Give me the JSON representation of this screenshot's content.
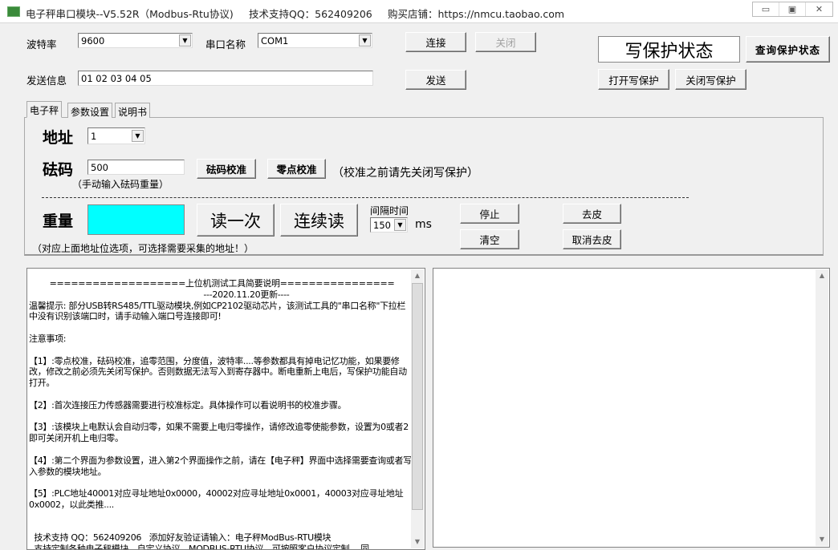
{
  "window": {
    "title": "电子秤串口模块--V5.52R（Modbus-Rtu协议)",
    "support": "技术支持QQ：562409206",
    "shop": "购买店铺：https://nmcu.taobao.com",
    "controls": {
      "minimize": "▭",
      "maximize": "▣",
      "close": "✕"
    }
  },
  "serial": {
    "baud_label": "波特率",
    "baud_value": "9600",
    "port_label": "串口名称",
    "port_value": "COM1",
    "connect": "连接",
    "close": "关闭",
    "send_label": "发送信息",
    "send_value": "01 02 03 04 05",
    "send": "发送"
  },
  "protect": {
    "status": "写保护状态",
    "query": "查询保护状态",
    "open": "打开写保护",
    "close": "关闭写保护"
  },
  "tabs": [
    {
      "label": "电子秤",
      "active": true
    },
    {
      "label": "参数设置"
    },
    {
      "label": "说明书"
    }
  ],
  "scale": {
    "addr_label": "地址",
    "addr_value": "1",
    "weight_label": "砝码",
    "weight_value": "500",
    "weight_hint": "（手动输入砝码重量）",
    "cal_weight": "砝码校准",
    "cal_zero": "零点校准",
    "cal_note": "（校准之前请先关闭写保护）",
    "reading_label": "重量",
    "reading_value": "",
    "reading_color": "#00ffff",
    "read_once": "读一次",
    "read_cont": "连续读",
    "interval_label": "间隔时间",
    "interval_value": "150",
    "interval_unit": "ms",
    "stop": "停止",
    "clear": "清空",
    "tare": "去皮",
    "cancel_tare": "取消去皮",
    "footnote": "（对应上面地址位选项，可选择需要采集的地址！）"
  },
  "instructions": "        ===================上位机测试工具简要说明================\n                                                                    ---2020.11.20更新----\n温馨提示: 部分USB转RS485/TTL驱动模块,例如CP2102驱动芯片，该测试工具的\"串口名称\"下拉栏中没有识别该端口时，请手动输入端口号连接即可!\n\n注意事项:\n\n【1】:零点校准，砝码校准，追零范围，分度值，波特率....等参数都具有掉电记忆功能，如果要修改，修改之前必须先关闭写保护。否则数据无法写入到寄存器中。断电重新上电后，写保护功能自动打开。\n\n【2】:首次连接压力传感器需要进行校准标定。具体操作可以看说明书的校准步骤。\n\n【3】:该模块上电默认会自动归零，如果不需要上电归零操作，请修改追零使能参数，设置为0或者2即可关闭开机上电归零。\n\n【4】:第二个界面为参数设置，进入第2个界面操作之前，请在【电子秤】界面中选择需要查询或者写入参数的模块地址。\n\n【5】:PLC地址40001对应寻址地址0x0000，40002对应寻址地址0x0001，40003对应寻址地址0x0002，以此类推....\n\n\n  技术支持 QQ：562409206   添加好友验证请输入：电子秤ModBus-RTU模块\n  支持定制各种电子秤模块。自定义协议、MODBUS-RTU协议、可按照客户协议定制。 同",
  "log": ""
}
